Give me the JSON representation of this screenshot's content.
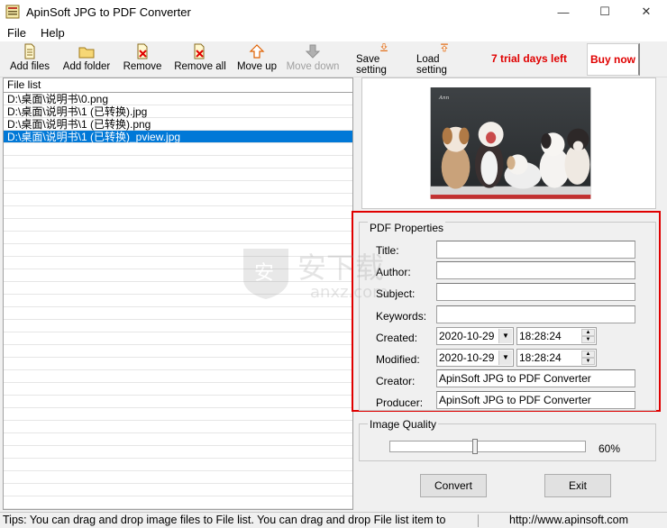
{
  "window": {
    "title": "ApinSoft JPG to PDF Converter",
    "controls": [
      "—",
      "☐",
      "✕"
    ]
  },
  "menu": {
    "items": [
      "File",
      "Help"
    ]
  },
  "toolbar": {
    "add_files": "Add files",
    "add_folder": "Add folder",
    "remove": "Remove",
    "remove_all": "Remove all",
    "move_up": "Move up",
    "move_down": "Move down",
    "save_setting": "Save setting",
    "load_setting": "Load setting",
    "trial": "7 trial days left",
    "buy_now": "Buy now"
  },
  "file_list": {
    "header": "File list",
    "items": [
      "D:\\桌面\\说明书\\0.png",
      "D:\\桌面\\说明书\\1 (已转换).jpg",
      "D:\\桌面\\说明书\\1 (已转换).png",
      "D:\\桌面\\说明书\\1 (已转换)_pview.jpg"
    ],
    "selected_index": 3
  },
  "pdf_properties": {
    "legend": "PDF Properties",
    "title_label": "Title:",
    "title_value": "",
    "author_label": "Author:",
    "author_value": "",
    "subject_label": "Subject:",
    "subject_value": "",
    "keywords_label": "Keywords:",
    "keywords_value": "",
    "created_label": "Created:",
    "created_date": "2020-10-29",
    "created_time": "18:28:24",
    "modified_label": "Modified:",
    "modified_date": "2020-10-29",
    "modified_time": "18:28:24",
    "creator_label": "Creator:",
    "creator_value": "ApinSoft JPG to PDF Converter",
    "producer_label": "Producer:",
    "producer_value": "ApinSoft JPG to PDF Converter"
  },
  "image_quality": {
    "legend": "Image Quality",
    "value_text": "60%",
    "value": 60
  },
  "actions": {
    "convert": "Convert",
    "exit": "Exit"
  },
  "status": {
    "tips": "Tips: You can drag and drop image files to File list. You can drag and drop File list item to",
    "url": "http://www.apinsoft.com"
  },
  "watermark": {
    "text": "安下载",
    "subtext": "anxz.com"
  },
  "colors": {
    "accent_red": "#e00000",
    "selection": "#0078d7"
  }
}
